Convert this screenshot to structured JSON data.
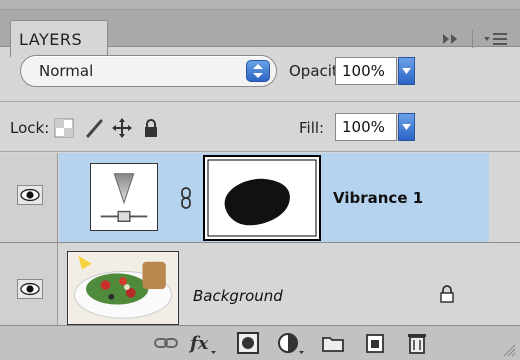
{
  "panel": {
    "tab_title": "LAYERS",
    "blend_mode": "Normal",
    "opacity_label": "Opacity:",
    "opacity_value": "100%",
    "lock_label": "Lock:",
    "fill_label": "Fill:",
    "fill_value": "100%"
  },
  "layers": [
    {
      "name": "Vibrance 1",
      "visible": true,
      "selected": true,
      "type": "adjustment"
    },
    {
      "name": "Background",
      "visible": true,
      "selected": false,
      "locked": true,
      "type": "image"
    }
  ],
  "colors": {
    "selection": "#b5d3ef",
    "accent_blue": "#2b63c4",
    "panel_bg": "#d6d6d6"
  },
  "icons": {
    "tab_controls": [
      "collapse-icon",
      "panel-menu-icon"
    ],
    "lock": [
      "lock-transparent-icon",
      "lock-paint-icon",
      "lock-move-icon",
      "lock-all-icon"
    ],
    "bottom_toolbar": [
      "link-icon",
      "fx-icon",
      "mask-icon",
      "adjustment-icon",
      "folder-icon",
      "new-layer-icon",
      "trash-icon"
    ]
  }
}
